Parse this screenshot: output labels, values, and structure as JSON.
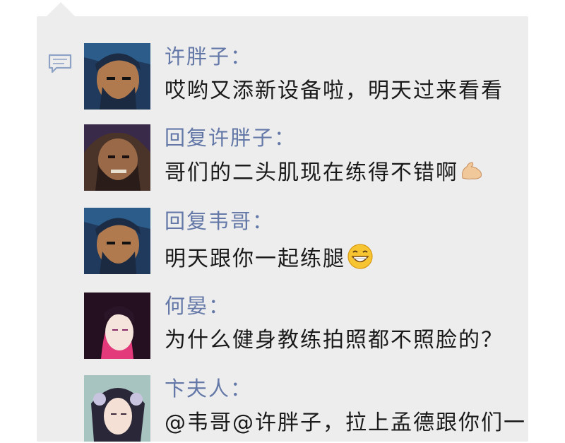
{
  "comments": [
    {
      "name": "许胖子：",
      "text": "哎哟又添新设备啦，明天过来看看",
      "emoji": ""
    },
    {
      "name": "回复许胖子：",
      "text": "哥们的二头肌现在练得不错啊",
      "emoji": "flexed-biceps-icon"
    },
    {
      "name": "回复韦哥：",
      "text": "明天跟你一起练腿",
      "emoji": "grinning-face-icon"
    },
    {
      "name": "何晏：",
      "text": "为什么健身教练拍照都不照脸的？",
      "emoji": ""
    },
    {
      "name": "卞夫人：",
      "text": "@韦哥@许胖子，拉上孟德跟你们一",
      "emoji": ""
    }
  ]
}
